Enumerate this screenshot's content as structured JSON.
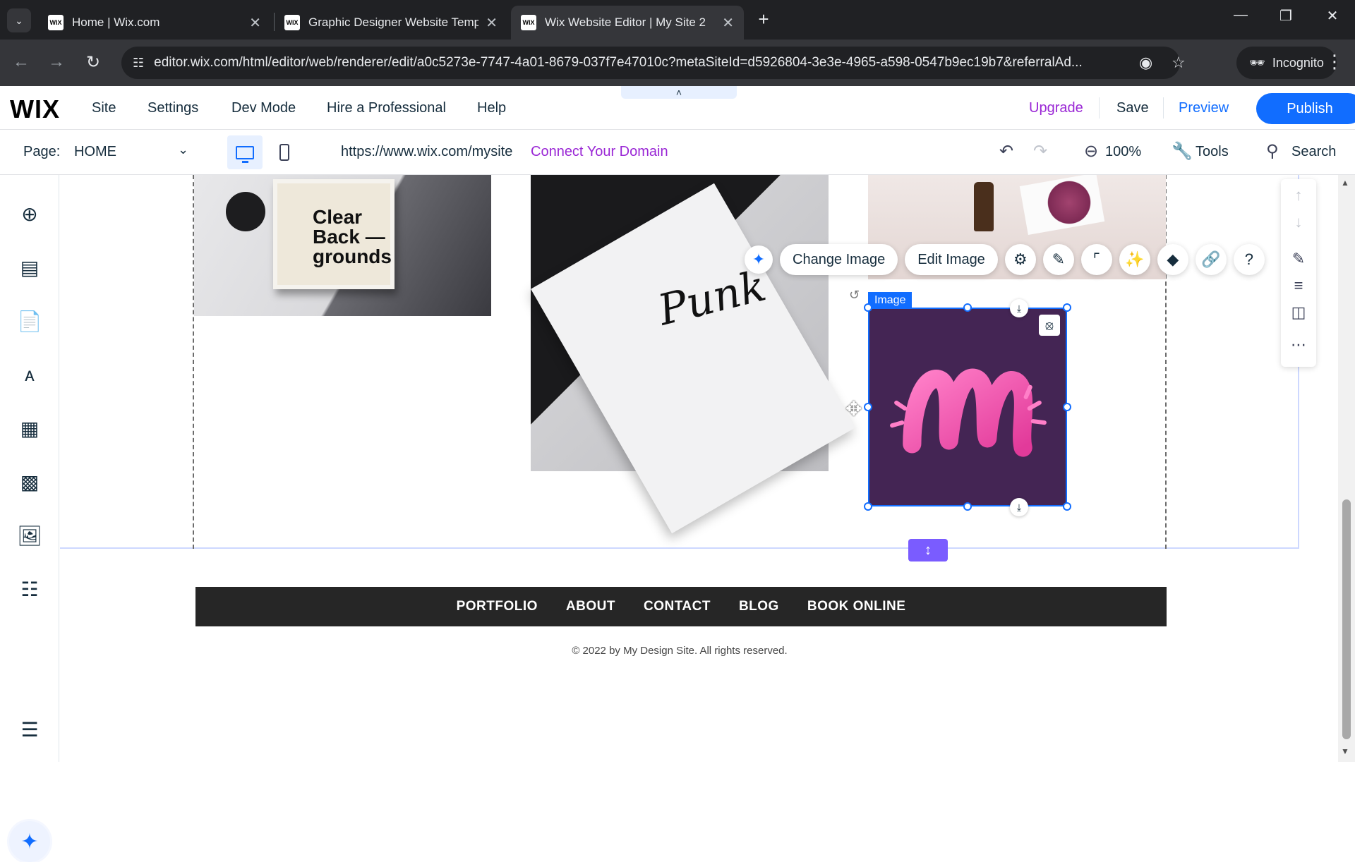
{
  "browser": {
    "tabs": [
      {
        "title": "Home | Wix.com",
        "favicon": "WIX",
        "active": false
      },
      {
        "title": "Graphic Designer Website Temp",
        "favicon": "WIX",
        "active": false
      },
      {
        "title": "Wix Website Editor | My Site 2",
        "favicon": "WIX",
        "active": true
      }
    ],
    "url": "editor.wix.com/html/editor/web/renderer/edit/a0c5273e-7747-4a01-8679-037f7e47010c?metaSiteId=d5926804-3e3e-4965-a598-0547b9ec19b7&referralAd...",
    "incognito_label": "Incognito"
  },
  "wix_topbar": {
    "logo": "WIX",
    "menu": [
      "Site",
      "Settings",
      "Dev Mode",
      "Hire a Professional",
      "Help"
    ],
    "upgrade": "Upgrade",
    "save": "Save",
    "preview": "Preview",
    "publish": "Publish"
  },
  "pagebar": {
    "page_label": "Page:",
    "page_name": "HOME",
    "site_url": "https://www.wix.com/mysite",
    "connect_domain": "Connect Your Domain",
    "zoom": "100%",
    "tools": "Tools",
    "search": "Search"
  },
  "canvas": {
    "photo1_text": "Clear Back — grounds",
    "photo2_text": "Punk",
    "image_toolbar": {
      "change_image": "Change Image",
      "edit_image": "Edit Image"
    },
    "selected_label": "Image",
    "footer_nav": [
      "PORTFOLIO",
      "ABOUT",
      "CONTACT",
      "BLOG",
      "BOOK ONLINE"
    ],
    "copyright": "© 2022 by My Design Site. All rights reserved."
  },
  "colors": {
    "accent": "#116dff",
    "upgrade": "#9a27d5",
    "selected_image_bg": "#442554",
    "footer_bg": "#262626"
  }
}
